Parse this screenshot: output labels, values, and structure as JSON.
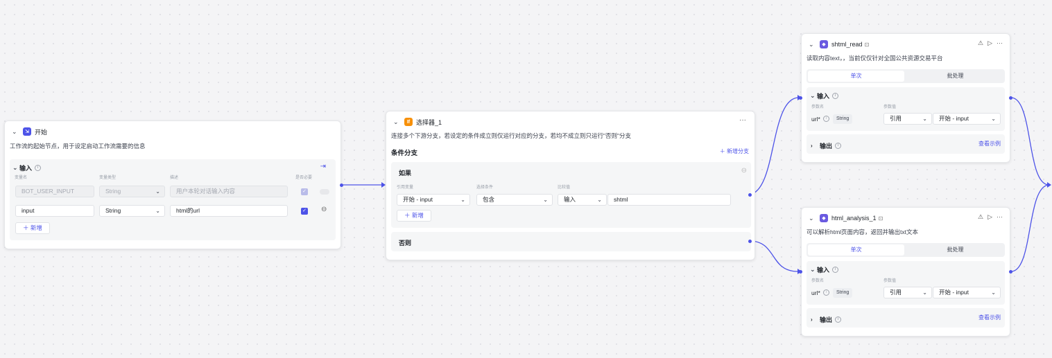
{
  "start": {
    "title": "开始",
    "desc": "工作流的起始节点，用于设定启动工作流需要的信息",
    "input_label": "输入",
    "columns": [
      "变量名",
      "变量类型",
      "描述",
      "是否必要"
    ],
    "row_sys": {
      "name": "BOT_USER_INPUT",
      "type": "String",
      "desc": "用户本轮对话输入内容"
    },
    "row_user": {
      "name": "input",
      "type": "String",
      "desc": "html的url"
    },
    "add_label": "新增"
  },
  "selector": {
    "title": "选择器_1",
    "desc": "连接多个下游分支，若设定的条件成立则仅运行对应的分支，若均不成立则只运行\"否则\"分支",
    "section_title": "条件分支",
    "add_branch": "新增分支",
    "if_label": "如果",
    "cond_cols": [
      "引用变量",
      "选择条件",
      "比较值"
    ],
    "ref_var": "开始 - input",
    "condition": "包含",
    "compare_type": "输入",
    "compare_value": "shtml",
    "add_label": "新增",
    "else_label": "否则"
  },
  "shtml": {
    "title": "shtml_read",
    "desc": "读取内容text，，当前仅仅针对全国公共资源交易平台",
    "tab_single": "单次",
    "tab_batch": "批处理",
    "input_label": "输入",
    "col_name": "参数名",
    "col_value": "参数值",
    "param": "url*",
    "type": "String",
    "ref": "引用",
    "value": "开始 - input",
    "output_label": "输出",
    "view_example": "查看示例"
  },
  "html": {
    "title": "html_analysis_1",
    "desc": "可以解析html页面内容，返回并输出txt文本",
    "tab_single": "单次",
    "tab_batch": "批处理",
    "input_label": "输入",
    "col_name": "参数名",
    "col_value": "参数值",
    "param": "url*",
    "type": "String",
    "ref": "引用",
    "value": "开始 - input",
    "output_label": "输出",
    "view_example": "查看示例"
  },
  "icons": [
    "chevron-down-icon",
    "start-node-icon",
    "if-icon",
    "plugin-icon",
    "info-icon",
    "more-icon",
    "play-icon",
    "debug-icon",
    "export-icon",
    "minus-circle-icon",
    "plus-icon"
  ],
  "colors": {
    "accent": "#4d53e8",
    "if_orange": "#f79009"
  }
}
